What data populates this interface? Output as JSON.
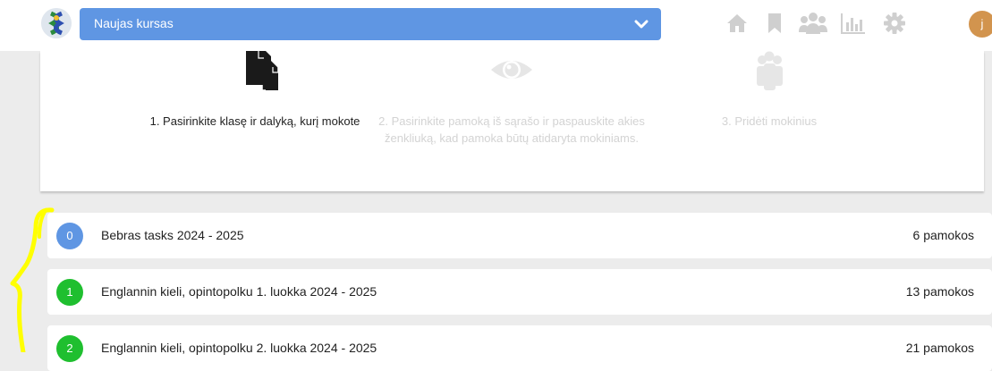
{
  "header": {
    "course_select": {
      "selected": "Naujas kursas"
    },
    "nav_icons": [
      "home-icon",
      "bookmark-icon",
      "users-icon",
      "bar-chart-icon",
      "gear-icon"
    ],
    "avatar_initial": "j"
  },
  "steps": [
    {
      "icon": "copy-documents-icon",
      "text": "1. Pasirinkite klasę ir dalyką, kurį mokote",
      "active": true
    },
    {
      "icon": "eye-icon",
      "text": "2. Pasirinkite pamoką iš sąrašo ir paspauskite akies ženkliuką, kad pamoka būtų atidaryta mokiniams.",
      "active": false
    },
    {
      "icon": "users-group-icon",
      "text": "3. Pridėti mokinius",
      "active": false
    }
  ],
  "courses": [
    {
      "index": "0",
      "title": "Bebras tasks 2024 - 2025",
      "count": "6 pamokos",
      "color": "#5f96e3"
    },
    {
      "index": "1",
      "title": "Englannin kieli, opintopolku 1. luokka 2024 - 2025",
      "count": "13 pamokos",
      "color": "#1fbf2f"
    },
    {
      "index": "2",
      "title": "Englannin kieli, opintopolku 2. luokka 2024 - 2025",
      "count": "21 pamokos",
      "color": "#1fbf2f"
    }
  ],
  "colors": {
    "accent": "#5f96e3",
    "green": "#1fbf2f",
    "avatar": "#d2944e",
    "annotation": "#ffff00"
  }
}
